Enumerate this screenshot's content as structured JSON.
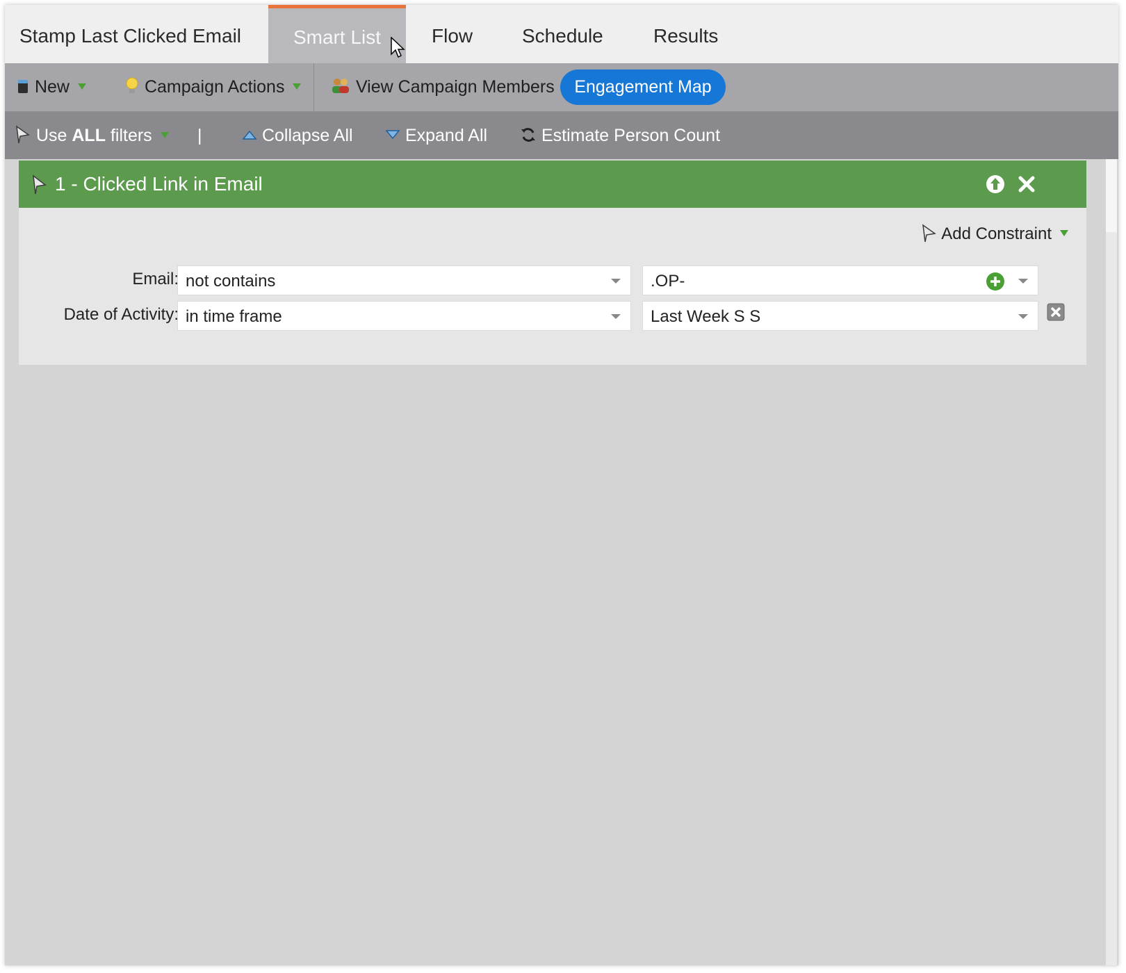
{
  "tabs": {
    "campaign_title": "Stamp Last Clicked Email",
    "smart_list": "Smart List",
    "flow": "Flow",
    "schedule": "Schedule",
    "results": "Results"
  },
  "toolbar": {
    "new_label": "New",
    "campaign_actions_label": "Campaign Actions",
    "view_members_label": "View Campaign Members",
    "engagement_map_label": "Engagement Map"
  },
  "filter_toolbar": {
    "use_label": "Use",
    "all_label": "ALL",
    "filters_label": "filters",
    "separator": "|",
    "collapse_label": "Collapse All",
    "expand_label": "Expand All",
    "estimate_label": "Estimate Person Count"
  },
  "filter": {
    "title": "1 - Clicked Link in Email",
    "add_constraint_label": "Add Constraint",
    "rows": [
      {
        "label": "Email:",
        "operator": "not contains",
        "value": ".OP-"
      },
      {
        "label": "Date of Activity:",
        "operator": "in time frame",
        "value": "Last Week S S"
      }
    ]
  },
  "colors": {
    "accent_tab": "#e8743b",
    "engagement_button": "#1677d6",
    "filter_header": "#5c9a4e"
  },
  "icons": [
    "new-icon",
    "lightbulb-icon",
    "members-icon",
    "filter-icon",
    "triangle-up-icon",
    "triangle-down-icon",
    "refresh-icon",
    "move-up-icon",
    "close-icon",
    "add-icon",
    "remove-constraint-icon",
    "cursor-icon"
  ]
}
